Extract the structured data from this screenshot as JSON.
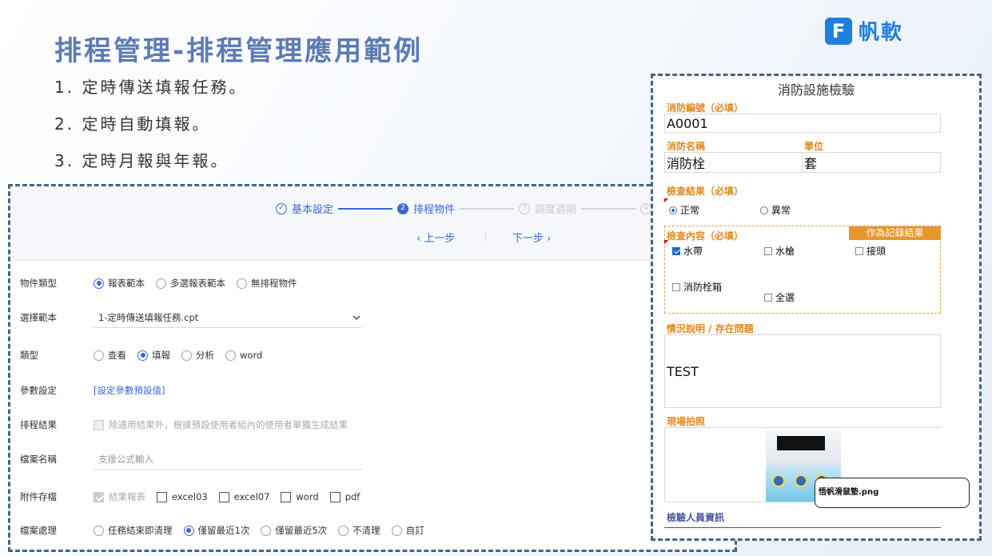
{
  "slide": {
    "title": "排程管理-排程管理應用範例",
    "logo_text": "帆軟",
    "logo_mark": "F",
    "bullets": [
      "1.  定時傳送填報任務。",
      "2.  定時自動填報。",
      "3.  定時月報與年報。"
    ]
  },
  "wizard": {
    "steps": [
      {
        "label": "基本設定",
        "state": "done",
        "marker": "✓"
      },
      {
        "label": "排程物件",
        "state": "active",
        "marker": "2"
      },
      {
        "label": "調度週期",
        "state": "todo",
        "marker": "3"
      },
      {
        "label": "",
        "state": "todo",
        "marker": "4"
      }
    ],
    "prev_label": "‹  上一步",
    "next_label": "下一步  ›"
  },
  "form": {
    "object_type": {
      "label": "物件類型",
      "options": [
        "報表範本",
        "多選報表範本",
        "無排程物件"
      ],
      "selected": 0
    },
    "template": {
      "label": "選擇範本",
      "value": "1-定時傳送填報任務.cpt"
    },
    "type": {
      "label": "類型",
      "options": [
        "查看",
        "填報",
        "分析",
        "word"
      ],
      "selected": 1
    },
    "params": {
      "label": "參數設定",
      "link": "[設定參數預設值]"
    },
    "result": {
      "label": "排程結果",
      "text": "除通用結果外，根據預設使用者組內的使用者單獨生成結果"
    },
    "filename": {
      "label": "檔案名稱",
      "placeholder": "支援公式輸入"
    },
    "attach": {
      "label": "附件存檔",
      "options": [
        "結果報表",
        "excel03",
        "excel07",
        "word",
        "pdf"
      ]
    },
    "handling": {
      "label": "檔案處理",
      "options": [
        "任務結束即清理",
        "僅留最近1次",
        "僅留最近5次",
        "不清理",
        "自訂"
      ],
      "selected": 1
    }
  },
  "inspection": {
    "title": "消防設施檢驗",
    "id_label": "消防編號（必填）",
    "id_value": "A0001",
    "name_label": "消防名稱",
    "name_value": "消防栓",
    "unit_label": "單位",
    "unit_value": "套",
    "result_label": "檢查結果（必填）",
    "result_options": [
      "正常",
      "異常"
    ],
    "content_label": "檢查內容（必填）",
    "record_button": "作為記錄結果",
    "content_options": [
      "水帶",
      "水槍",
      "接頭",
      "消防栓箱",
      "全選"
    ],
    "desc_label": "情況說明 / 存在問題",
    "desc_value": "TEST",
    "photo_label": "現場拍照",
    "photo_file": "悟帆滑鼠墊.png",
    "inspector_label": "檢驗人員資訊"
  },
  "colors": {
    "accent": "#3a69d6",
    "title": "#5b7bb5",
    "orange": "#e08a1e",
    "border": "#3f6787"
  }
}
